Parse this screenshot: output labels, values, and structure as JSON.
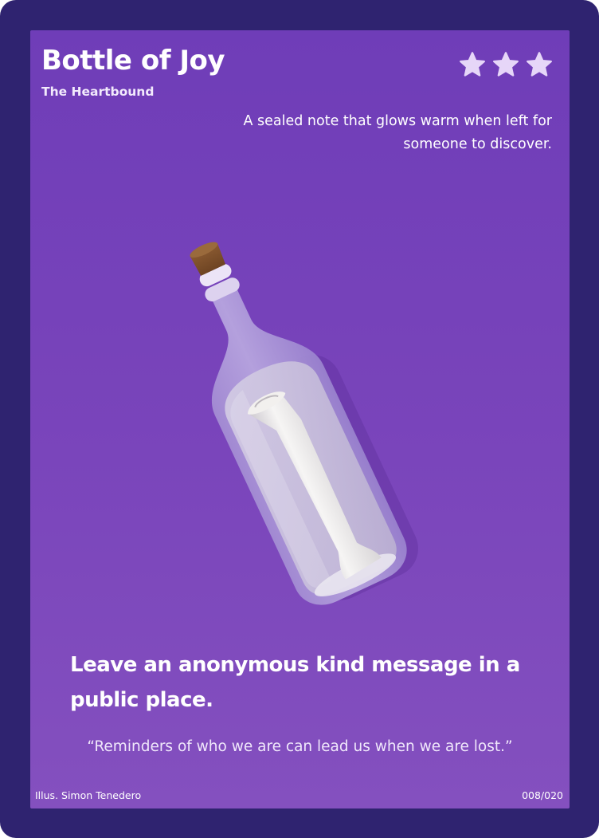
{
  "card": {
    "title": "Bottle of Joy",
    "subtitle": "The Heartbound",
    "rating": 3,
    "rating_icon": "star-icon",
    "description": "A sealed note that glows warm when left for someone to discover.",
    "illustration": "message-in-a-bottle-illustration",
    "challenge": "Leave an anonymous kind message in a public place.",
    "quote": "“Reminders of who we are can lead us when we are lost.”",
    "credit": "Illus. Simon Tenedero",
    "serial": "008/020"
  },
  "colors": {
    "frame": "#2f2370",
    "panel": "#7a45bb",
    "star": "#e6d6f8",
    "text": "#ffffff"
  }
}
